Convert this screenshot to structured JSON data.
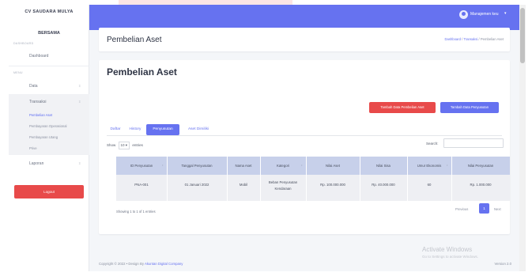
{
  "sidebar": {
    "brand": "CV SAUDARA MULYA",
    "brand2": "BERSAMA",
    "section_dashboard": "DASHBOARD",
    "section_menu": "MENU",
    "dashboard_label": "Dashboard",
    "data_label": "Data",
    "transaksi_label": "Transaksi",
    "sub": [
      "Pembelian Aset",
      "Pembayaran Operasional",
      "Pembayaran Utang",
      "Prive"
    ],
    "laporan_label": "Laporan",
    "logout_label": "Logout"
  },
  "topbar": {
    "user_name": "Manajemen keu"
  },
  "header": {
    "title": "Pembelian Aset",
    "breadcrumb": [
      "Dashboard",
      "Transaksi",
      "Pembelian Aset"
    ]
  },
  "card": {
    "title": "Pembelian Aset",
    "btn_pembelian": "Tambah Data Pembelian Aset",
    "btn_penyusutan": "Tambah Data Penyusutan",
    "tabs": [
      "Daftar",
      "History",
      "Penyusutan",
      "Aset Dimiliki"
    ],
    "active_tab": "Penyusutan",
    "show_label": "Show",
    "entries_value": "10",
    "entries_label": "entries",
    "search_label": "Search:",
    "columns": [
      "ID Penyusutan",
      "Tanggal Penyusutan",
      "Nama Aset",
      "Kategori",
      "Nilai Aset",
      "Nilai Sisa",
      "Umur Ekonomis",
      "Nilai Penyusutan"
    ],
    "rows": [
      [
        "PNA-001",
        "01 Januari 2022",
        "Mobil",
        "Beban Penyusutan Kendaraan",
        "Rp. 100.000.000",
        "Rp. 40.000.000",
        "60",
        "Rp. 1.000.000"
      ]
    ],
    "info": "Showing 1 to 1 of 1 entries",
    "prev": "Previous",
    "page": "1",
    "next": "Next"
  },
  "footer": {
    "copyright": "Copyright © 2022 • Design By",
    "company": "Akuntan Digital Company",
    "version": "Version 2.0"
  },
  "windows": {
    "activate_title": "Activate Windows",
    "activate_sub": "Go to Settings to activate Windows."
  },
  "colors": {
    "primary": "#6672f0",
    "danger": "#e84a4a"
  }
}
